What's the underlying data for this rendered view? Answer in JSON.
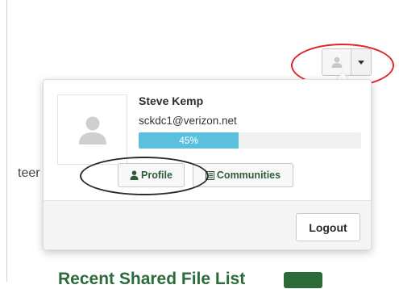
{
  "background": {
    "left_text": "teer",
    "heading": "Recent Shared File List"
  },
  "user_menu": {
    "avatar_icon": "user-silhouette-icon",
    "caret_icon": "caret-down-icon"
  },
  "profile_card": {
    "name": "Steve Kemp",
    "email": "sckdc1@verizon.net",
    "progress": {
      "label": "45%",
      "fraction": 0.45
    },
    "buttons": {
      "profile_label": "Profile",
      "communities_label": "Communities",
      "logout_label": "Logout"
    }
  },
  "colors": {
    "progress_fill": "#5bc0de",
    "accent_green": "#2e6b3b",
    "annotation_red": "#e0262a",
    "annotation_dark": "#2a2a2a"
  }
}
